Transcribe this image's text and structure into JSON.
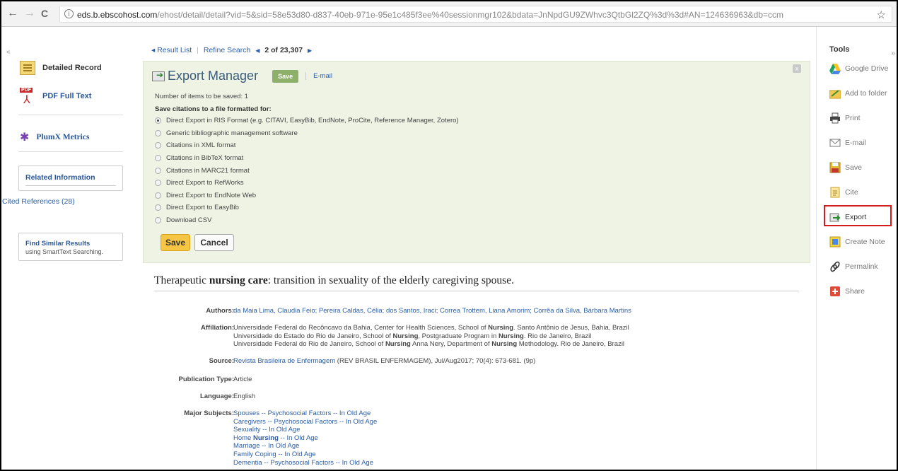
{
  "browser": {
    "url_host": "eds.b.ebscohost.com",
    "url_rest": "/ehost/detail/detail?vid=5&sid=58e53d80-d837-40eb-971e-95e1c485f3ee%40sessionmgr102&bdata=JnNpdGU9ZWhvc3QtbGl2ZQ%3d%3d#AN=124636963&db=ccm",
    "back": "←",
    "forward": "→",
    "reload": "C",
    "info": "i",
    "star": "☆"
  },
  "left": {
    "collapse": "«",
    "detailed_record": "Detailed Record",
    "pdf_full_text": "PDF Full Text",
    "pdf_tag": "PDF",
    "plumx": "PlumX Metrics",
    "related_info": "Related Information",
    "cited_refs": "Cited References (28)",
    "find_similar": "Find Similar Results",
    "smarttext": "using SmartText Searching."
  },
  "crumbs": {
    "result_list": "Result List",
    "refine_search": "Refine Search",
    "position": "2",
    "of_total": "of 23,307"
  },
  "export": {
    "title": "Export Manager",
    "save_tab": "Save",
    "email_tab": "E-mail",
    "close": "x",
    "count_text": "Number of items to be saved: 1",
    "save_citations": "Save citations to a file formatted for:",
    "options": [
      {
        "label": "Direct Export in RIS Format (e.g. CITAVI, EasyBib, EndNote, ProCite, Reference Manager, Zotero)",
        "selected": true
      },
      {
        "label": "Generic bibliographic management software",
        "selected": false
      },
      {
        "label": "Citations in XML format",
        "selected": false
      },
      {
        "label": "Citations in BibTeX format",
        "selected": false
      },
      {
        "label": "Citations in MARC21 format",
        "selected": false
      },
      {
        "label": "Direct Export to RefWorks",
        "selected": false
      },
      {
        "label": "Direct Export to EndNote Web",
        "selected": false
      },
      {
        "label": "Direct Export to EasyBib",
        "selected": false
      },
      {
        "label": "Download CSV",
        "selected": false
      }
    ],
    "save_button": "Save",
    "cancel_button": "Cancel"
  },
  "article": {
    "title_pre": "Therapeutic ",
    "title_bold": "nursing care",
    "title_post": ": transition in sexuality of the elderly caregiving spouse.",
    "authors_label": "Authors:",
    "authors": "da Maia Lima, Claudia Feio; Pereira Caldas, Célia; dos Santos, Iraci; Correa Trottem, Liana Amorim; Corrêa da Silva, Bárbara Martins",
    "affiliation_label": "Affiliation:",
    "affiliations": [
      [
        "Universidade Federal do Recôncavo da Bahia, Center for Health Sciences, School of ",
        "Nursing",
        ". Santo Antônio de Jesus, Bahia, Brazil"
      ],
      [
        "Universidade do Estado do Rio de Janeiro, School of ",
        "Nursing",
        ", Postgraduate Program in ",
        "Nursing",
        ". Rio de Janeiro, Brazil"
      ],
      [
        "Universidade Federal do Rio de Janeiro, School of ",
        "Nursing",
        " Anna Nery, Department of ",
        "Nursing",
        " Methodology. Rio de Janeiro, Brazil"
      ]
    ],
    "source_label": "Source:",
    "source_link": "Revista Brasileira de Enfermagem",
    "source_rest": " (REV BRASIL ENFERMAGEM), Jul/Aug2017; 70(4): 673-681. (9p)",
    "pubtype_label": "Publication Type:",
    "pubtype": "Article",
    "language_label": "Language:",
    "language": "English",
    "subjects_label": "Major Subjects:",
    "subjects": [
      "Spouses -- Psychosocial Factors -- In Old Age",
      "Caregivers -- Psychosocial Factors -- In Old Age",
      "Sexuality -- In Old Age",
      "Home Nursing -- In Old Age",
      "Marriage -- In Old Age",
      "Family Coping -- In Old Age",
      "Dementia -- Psychosocial Factors -- In Old Age"
    ]
  },
  "tools": {
    "title": "Tools",
    "collapse": "»",
    "google_drive": "Google Drive",
    "add_to_folder": "Add to folder",
    "print": "Print",
    "email": "E-mail",
    "save": "Save",
    "cite": "Cite",
    "export": "Export",
    "create_note": "Create Note",
    "permalink": "Permalink",
    "share": "Share"
  },
  "colors": {
    "link": "#2b5ea7",
    "panel_bg": "#eef3e4",
    "save_button": "#f6c544",
    "highlight": "#d21b1b"
  }
}
